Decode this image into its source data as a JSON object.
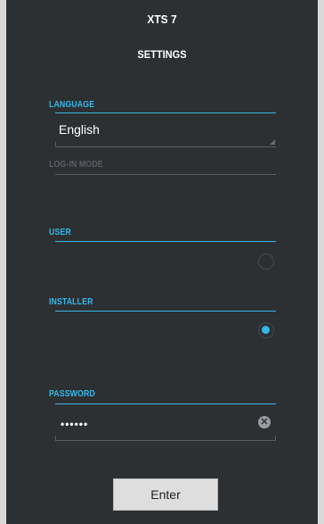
{
  "app": {
    "title": "XTS 7"
  },
  "page": {
    "title": "SETTINGS"
  },
  "language": {
    "label": "LANGUAGE",
    "value": "English"
  },
  "login_mode": {
    "label": "LOG-IN MODE"
  },
  "user": {
    "label": "USER",
    "selected": false
  },
  "installer": {
    "label": "INSTALLER",
    "selected": true
  },
  "password": {
    "label": "PASSWORD",
    "value": "••••••",
    "clear_icon": "clear-icon"
  },
  "actions": {
    "enter_label": "Enter"
  },
  "colors": {
    "accent": "#35b7e8",
    "background": "#2d3033",
    "muted": "#5a5e63"
  }
}
